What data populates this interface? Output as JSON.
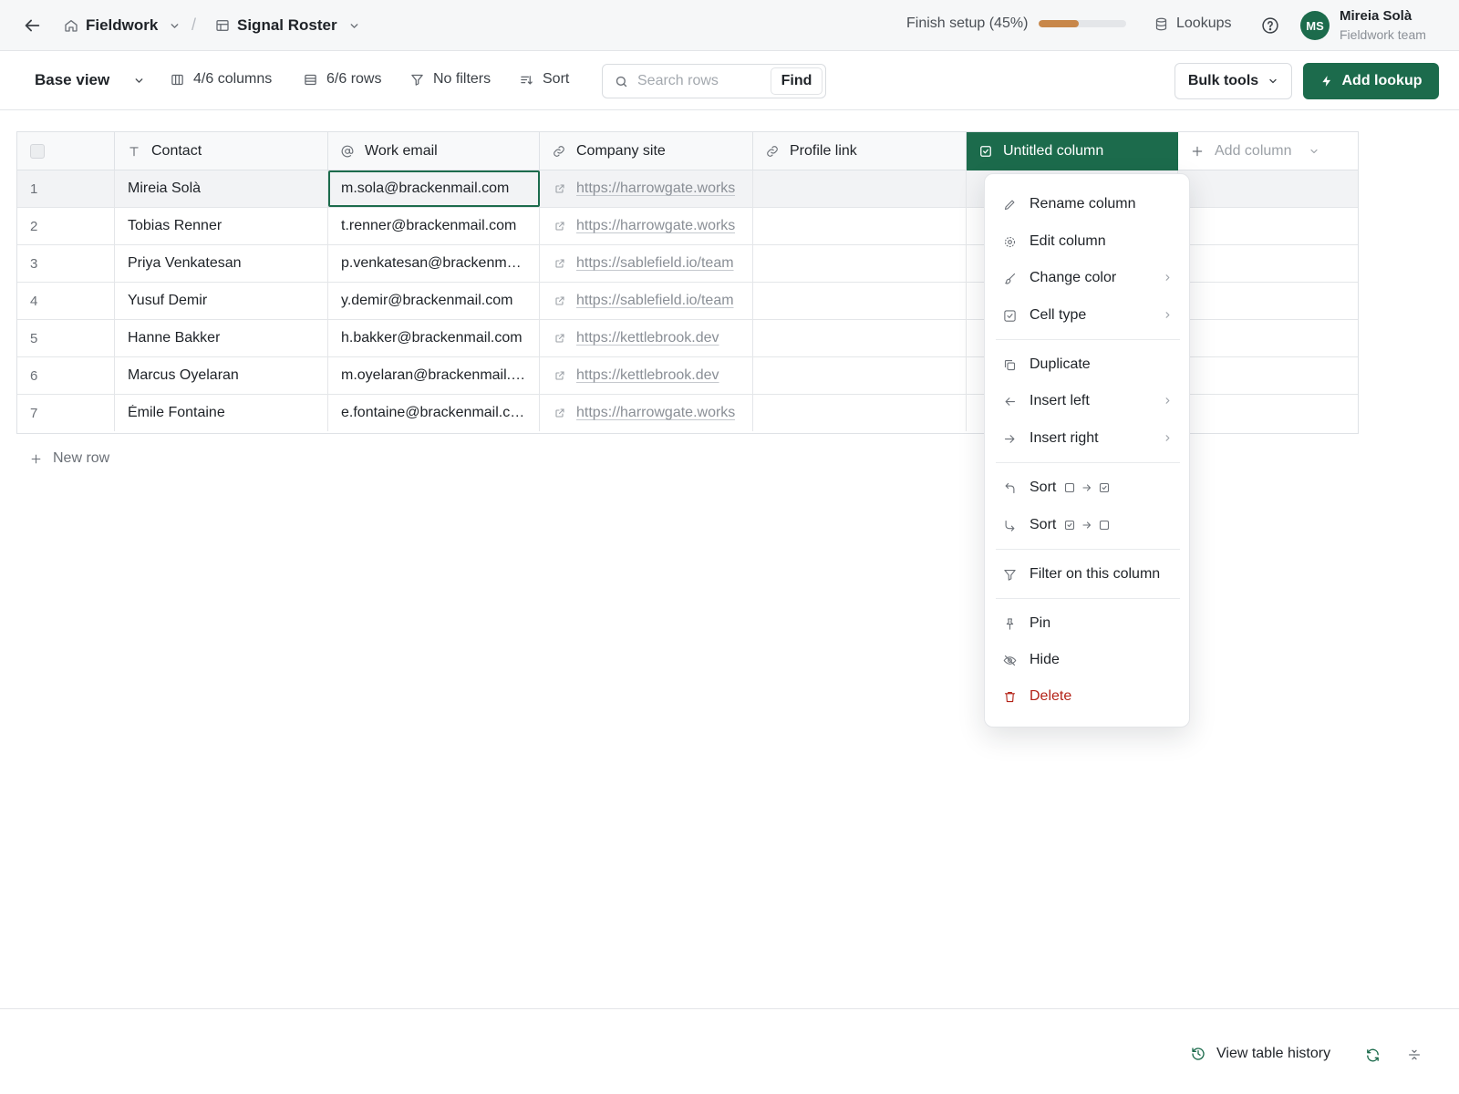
{
  "header": {
    "workspace": "Fieldwork",
    "separator": "/",
    "table": "Signal Roster",
    "setup_label": "Finish setup (45%)",
    "setup_progress": 0.45,
    "lookups_label": "Lookups",
    "user": {
      "initials": "MS",
      "name": "Mireia Solà",
      "team": "Fieldwork team"
    }
  },
  "toolbar": {
    "view": "Base view",
    "columns": "4/6 columns",
    "rows": "6/6 rows",
    "filters": "No filters",
    "sort": "Sort",
    "search_placeholder": "Search rows",
    "find": "Find",
    "bulk_tools": "Bulk tools",
    "add_lookup": "Add lookup"
  },
  "table": {
    "columns": [
      {
        "label": "Contact",
        "icon": "text-type-icon"
      },
      {
        "label": "Work email",
        "icon": "at-sign-icon"
      },
      {
        "label": "Company site",
        "icon": "link-icon"
      },
      {
        "label": "Profile link",
        "icon": "link-icon"
      },
      {
        "label": "Untitled column",
        "icon": "checkbox-icon"
      }
    ],
    "add_column": "Add column",
    "rows": [
      {
        "num": "1",
        "contact": "Mireia Solà",
        "email": "m.sola@brackenmail.com",
        "site": "https://harrowgate.works"
      },
      {
        "num": "2",
        "contact": "Tobias Renner",
        "email": "t.renner@brackenmail.com",
        "site": "https://harrowgate.works"
      },
      {
        "num": "3",
        "contact": "Priya Venkatesan",
        "email": "p.venkatesan@brackenmail.com",
        "site": "https://sablefield.io/team"
      },
      {
        "num": "4",
        "contact": "Yusuf Demir",
        "email": "y.demir@brackenmail.com",
        "site": "https://sablefield.io/team"
      },
      {
        "num": "5",
        "contact": "Hanne Bakker",
        "email": "h.bakker@brackenmail.com",
        "site": "https://kettlebrook.dev"
      },
      {
        "num": "6",
        "contact": "Marcus Oyelaran",
        "email": "m.oyelaran@brackenmail.com",
        "site": "https://kettlebrook.dev"
      },
      {
        "num": "7",
        "contact": "Émile Fontaine",
        "email": "e.fontaine@brackenmail.com",
        "site": "https://harrowgate.works"
      }
    ],
    "new_row": "New row"
  },
  "menu": {
    "rename": "Rename column",
    "edit": "Edit column",
    "change_color": "Change color",
    "cell_type": "Cell type",
    "duplicate": "Duplicate",
    "insert_left": "Insert left",
    "insert_right": "Insert right",
    "sort_asc": "Sort",
    "sort_desc": "Sort",
    "filter": "Filter on this column",
    "pin": "Pin",
    "hide": "Hide",
    "delete": "Delete"
  },
  "footer": {
    "history": "View table history"
  },
  "colors": {
    "accent": "#1c6b4c",
    "progress": "#c8874a",
    "danger": "#b42318"
  }
}
